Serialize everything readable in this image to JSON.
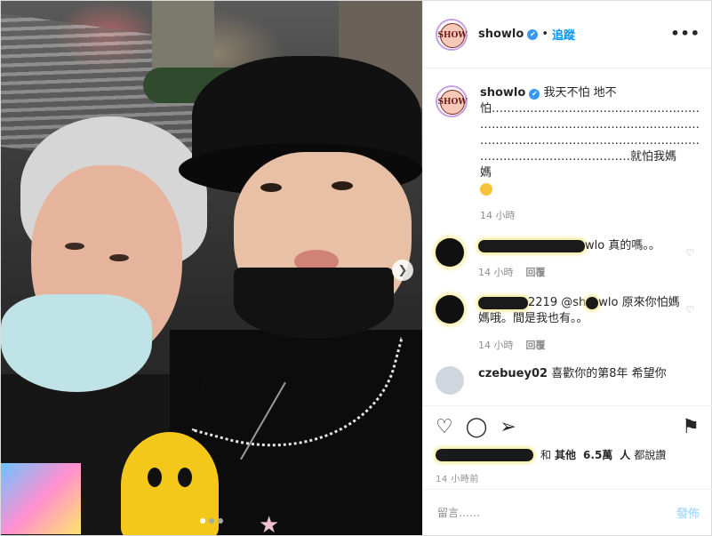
{
  "photo": {
    "next_icon": "chevron-right-icon",
    "carousel_dots": 3,
    "active_dot": 1
  },
  "header": {
    "avatar_text": "SHOW",
    "username": "showlo",
    "separator": "•",
    "follow_label": "追蹤",
    "more_label": "•••"
  },
  "caption": {
    "username": "showlo",
    "line1": "我天不怕 地不",
    "line2": "怕………………………………………………",
    "line3": "…………………………………………………",
    "line4": "…………………………………………………",
    "line5": "…………………………………就怕我媽媽",
    "time": "14 小時"
  },
  "comments": [
    {
      "username_tail": "wlo",
      "text": "真的嗎。。",
      "time": "14 小時",
      "reply_label": "回覆"
    },
    {
      "username_tail": "2219 @sh",
      "mention_tail": "wlo",
      "text": "原來你怕媽媽哦。間是我也有。。",
      "time": "14 小時",
      "reply_label": "回覆"
    }
  ],
  "partial_comment": {
    "username": "czebuey02",
    "text": "喜歡你的第8年 希望你"
  },
  "actions": {
    "like_icon": "heart-icon",
    "comment_icon": "comment-icon",
    "share_icon": "share-icon",
    "save_icon": "bookmark-icon"
  },
  "likes": {
    "and_label": "和",
    "others_label": "其他",
    "count": "6.5萬",
    "people_label": "人",
    "liked_label": "都說讚"
  },
  "post_time": "14 小時前",
  "add_comment": {
    "placeholder": "留言……",
    "post_label": "發佈"
  },
  "colors": {
    "link": "#0095f6",
    "verified": "#3897f0",
    "post_disabled": "#b2dffc"
  }
}
